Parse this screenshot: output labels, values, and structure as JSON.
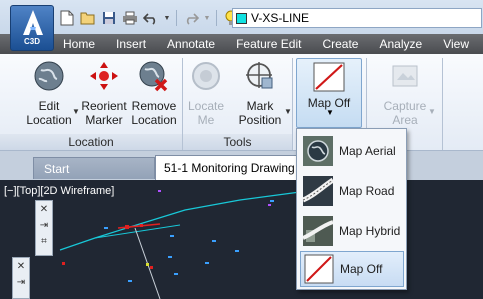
{
  "app": {
    "badge": "C3D"
  },
  "quick_access": {
    "icons": [
      "new-icon",
      "open-icon",
      "save-icon",
      "print-icon",
      "undo-icon",
      "redo-icon",
      "lightbulb-icon",
      "sun-icon",
      "lock-icon"
    ],
    "layer_name": "V-XS-LINE",
    "layer_color": "#11e1e1"
  },
  "menu": [
    "Home",
    "Insert",
    "Annotate",
    "Feature Edit",
    "Create",
    "Analyze",
    "View"
  ],
  "ribbon": {
    "location_panel": {
      "title": "Location",
      "buttons": [
        {
          "label1": "Edit",
          "label2": "Location"
        },
        {
          "label1": "Reorient",
          "label2": "Marker"
        },
        {
          "label1": "Remove",
          "label2": "Location"
        }
      ]
    },
    "tools_panel": {
      "title": "Tools",
      "buttons": [
        {
          "label1": "Locate",
          "label2": "Me"
        },
        {
          "label1": "Mark",
          "label2": "Position"
        }
      ]
    },
    "map_off": {
      "label": "Map Off"
    },
    "capture": {
      "label1": "Capture",
      "label2": "Area"
    }
  },
  "tabs": {
    "start": "Start",
    "document": "51-1 Monitoring Drawing"
  },
  "viewport": {
    "label": "[−][Top][2D Wireframe]"
  },
  "map_menu": {
    "items": [
      {
        "label": "Map Aerial",
        "selected": false
      },
      {
        "label": "Map Road",
        "selected": false
      },
      {
        "label": "Map Hybrid",
        "selected": false
      },
      {
        "label": "Map Off",
        "selected": true
      }
    ]
  },
  "colors": {
    "accent": "#1b4f93",
    "menubar": "#4a4c50",
    "drawing_bg": "#202733",
    "selection": "#c8dcf3"
  }
}
